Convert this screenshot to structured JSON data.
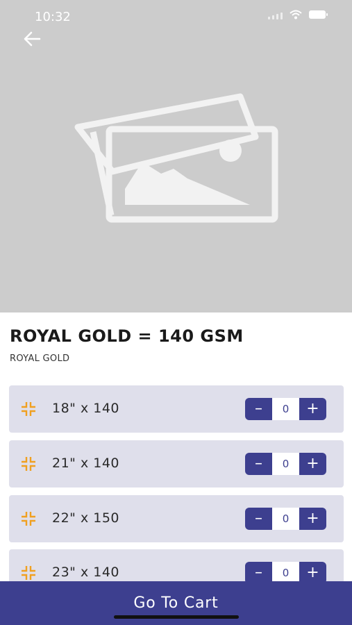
{
  "status_bar": {
    "time": "10:32"
  },
  "product": {
    "title": "ROYAL GOLD = 140 GSM",
    "subtitle": "ROYAL GOLD",
    "image_placeholder_icon": "image-placeholder-icon"
  },
  "sizes": [
    {
      "label": "18\" x 140",
      "quantity": "0"
    },
    {
      "label": "21\" x 140",
      "quantity": "0"
    },
    {
      "label": "22\" x 150",
      "quantity": "0"
    },
    {
      "label": "23\" x 140",
      "quantity": "0"
    }
  ],
  "stepper": {
    "minus": "–",
    "plus": "+"
  },
  "cart_button": {
    "label": "Go To Cart"
  },
  "colors": {
    "accent": "#3d3f8f",
    "row_bg": "#dfdfeb",
    "icon_orange": "#f0a020",
    "hero_bg": "#cccccc"
  }
}
